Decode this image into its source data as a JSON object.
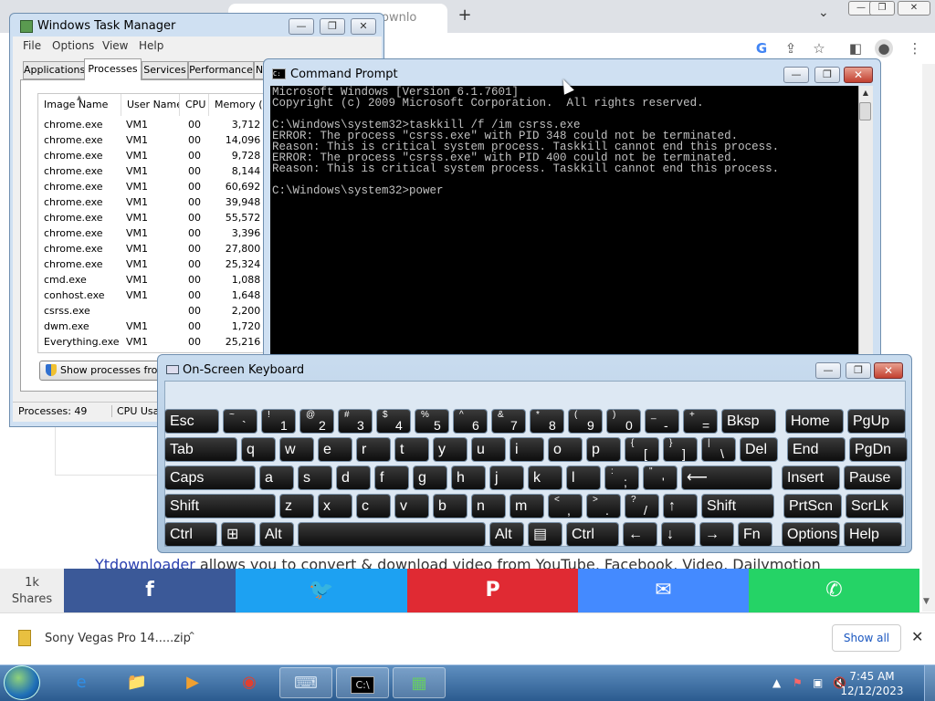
{
  "chrome": {
    "tab_fragment": "ownlo",
    "new_tab_glyph": "+",
    "tabs_dropdown_glyph": "⌄",
    "window_buttons": [
      "—",
      "❐",
      "✕"
    ],
    "omnibox_icons": [
      "google-icon",
      "share-icon",
      "star-icon",
      "sidebar-icon",
      "profile-icon",
      "menu-icon"
    ]
  },
  "page": {
    "ytd_link": "Ytdownloader",
    "ytd_text": " allows you to convert & download video from YouTube, Facebook, Video, Dailymotion",
    "shares_count": "1k",
    "shares_label": "Shares",
    "share_buttons": [
      {
        "name": "facebook",
        "glyph": "f",
        "color": "#3b5998"
      },
      {
        "name": "twitter",
        "glyph": "🐦",
        "color": "#1da1f2"
      },
      {
        "name": "pinterest",
        "glyph": "P",
        "color": "#e02a33"
      },
      {
        "name": "messenger",
        "glyph": "✉",
        "color": "#448aff"
      },
      {
        "name": "whatsapp",
        "glyph": "✆",
        "color": "#25d366"
      }
    ]
  },
  "download_bar": {
    "file_name": "Sony Vegas Pro 14.....zip",
    "chevron": "⌃",
    "show_all": "Show all",
    "close": "✕"
  },
  "task_manager": {
    "title": "Windows Task Manager",
    "menu": [
      "File",
      "Options",
      "View",
      "Help"
    ],
    "tabs": [
      "Applications",
      "Processes",
      "Services",
      "Performance",
      "N"
    ],
    "selected_tab": "Processes",
    "columns": [
      "Image Name",
      "User Name",
      "CPU",
      "Memory (..."
    ],
    "rows": [
      {
        "image": "chrome.exe",
        "user": "VM1",
        "cpu": "00",
        "mem": "3,712 K"
      },
      {
        "image": "chrome.exe",
        "user": "VM1",
        "cpu": "00",
        "mem": "14,096 K"
      },
      {
        "image": "chrome.exe",
        "user": "VM1",
        "cpu": "00",
        "mem": "9,728 K"
      },
      {
        "image": "chrome.exe",
        "user": "VM1",
        "cpu": "00",
        "mem": "8,144 K"
      },
      {
        "image": "chrome.exe",
        "user": "VM1",
        "cpu": "00",
        "mem": "60,692 K"
      },
      {
        "image": "chrome.exe",
        "user": "VM1",
        "cpu": "00",
        "mem": "39,948 K"
      },
      {
        "image": "chrome.exe",
        "user": "VM1",
        "cpu": "00",
        "mem": "55,572 K"
      },
      {
        "image": "chrome.exe",
        "user": "VM1",
        "cpu": "00",
        "mem": "3,396 K"
      },
      {
        "image": "chrome.exe",
        "user": "VM1",
        "cpu": "00",
        "mem": "27,800 K"
      },
      {
        "image": "chrome.exe",
        "user": "VM1",
        "cpu": "00",
        "mem": "25,324 K"
      },
      {
        "image": "cmd.exe",
        "user": "VM1",
        "cpu": "00",
        "mem": "1,088 K"
      },
      {
        "image": "conhost.exe",
        "user": "VM1",
        "cpu": "00",
        "mem": "1,648 K"
      },
      {
        "image": "csrss.exe",
        "user": "",
        "cpu": "00",
        "mem": "2,200 K"
      },
      {
        "image": "dwm.exe",
        "user": "VM1",
        "cpu": "00",
        "mem": "1,720 K"
      },
      {
        "image": "Everything.exe",
        "user": "VM1",
        "cpu": "00",
        "mem": "25,216 K"
      }
    ],
    "show_processes_btn": "Show processes from",
    "status_processes": "Processes: 49",
    "status_cpu": "CPU Usa"
  },
  "cmd": {
    "title": "Command Prompt",
    "lines": [
      "Microsoft Windows [Version 6.1.7601]",
      "Copyright (c) 2009 Microsoft Corporation.  All rights reserved.",
      "",
      "C:\\Windows\\system32>taskkill /f /im csrss.exe",
      "ERROR: The process \"csrss.exe\" with PID 348 could not be terminated.",
      "Reason: This is critical system process. Taskkill cannot end this process.",
      "ERROR: The process \"csrss.exe\" with PID 400 could not be terminated.",
      "Reason: This is critical system process. Taskkill cannot end this process.",
      "",
      "C:\\Windows\\system32>power"
    ]
  },
  "osk": {
    "title": "On-Screen Keyboard",
    "rows": [
      [
        {
          "id": "esc",
          "label": "Esc",
          "w": 60
        },
        {
          "id": "tilde",
          "sup": "~",
          "main": "`",
          "w": 38
        },
        {
          "id": "k1",
          "sup": "!",
          "main": "1",
          "w": 38
        },
        {
          "id": "k2",
          "sup": "@",
          "main": "2",
          "w": 38
        },
        {
          "id": "k3",
          "sup": "#",
          "main": "3",
          "w": 38
        },
        {
          "id": "k4",
          "sup": "$",
          "main": "4",
          "w": 38
        },
        {
          "id": "k5",
          "sup": "%",
          "main": "5",
          "w": 38
        },
        {
          "id": "k6",
          "sup": "^",
          "main": "6",
          "w": 38
        },
        {
          "id": "k7",
          "sup": "&",
          "main": "7",
          "w": 38
        },
        {
          "id": "k8",
          "sup": "*",
          "main": "8",
          "w": 38
        },
        {
          "id": "k9",
          "sup": "(",
          "main": "9",
          "w": 38
        },
        {
          "id": "k0",
          "sup": ")",
          "main": "0",
          "w": 38
        },
        {
          "id": "minus",
          "sup": "_",
          "main": "-",
          "w": 38
        },
        {
          "id": "equals",
          "sup": "+",
          "main": "=",
          "w": 38
        },
        {
          "id": "bksp",
          "label": "Bksp",
          "w": 60
        },
        {
          "id": "home",
          "label": "Home",
          "w": 64,
          "gap": 6
        },
        {
          "id": "pgup",
          "label": "PgUp",
          "w": 64
        }
      ],
      [
        {
          "id": "tab",
          "label": "Tab",
          "w": 80
        },
        {
          "id": "q",
          "label": "q",
          "w": 38
        },
        {
          "id": "w",
          "label": "w",
          "w": 38
        },
        {
          "id": "e",
          "label": "e",
          "w": 38
        },
        {
          "id": "r",
          "label": "r",
          "w": 38
        },
        {
          "id": "t",
          "label": "t",
          "w": 38
        },
        {
          "id": "y",
          "label": "y",
          "w": 38
        },
        {
          "id": "u",
          "label": "u",
          "w": 38
        },
        {
          "id": "i",
          "label": "i",
          "w": 38
        },
        {
          "id": "o",
          "label": "o",
          "w": 38
        },
        {
          "id": "p",
          "label": "p",
          "w": 38
        },
        {
          "id": "lbracket",
          "sup": "{",
          "main": "[",
          "w": 38
        },
        {
          "id": "rbracket",
          "sup": "}",
          "main": "]",
          "w": 38
        },
        {
          "id": "backslash",
          "sup": "|",
          "main": "\\",
          "w": 38
        },
        {
          "id": "del",
          "label": "Del",
          "w": 42
        },
        {
          "id": "end",
          "label": "End",
          "w": 64,
          "gap": 6
        },
        {
          "id": "pgdn",
          "label": "PgDn",
          "w": 64
        }
      ],
      [
        {
          "id": "caps",
          "label": "Caps",
          "w": 100
        },
        {
          "id": "a",
          "label": "a",
          "w": 38
        },
        {
          "id": "s",
          "label": "s",
          "w": 38
        },
        {
          "id": "d",
          "label": "d",
          "w": 38
        },
        {
          "id": "f",
          "label": "f",
          "w": 38
        },
        {
          "id": "g",
          "label": "g",
          "w": 38
        },
        {
          "id": "h",
          "label": "h",
          "w": 38
        },
        {
          "id": "j",
          "label": "j",
          "w": 38
        },
        {
          "id": "k",
          "label": "k",
          "w": 38
        },
        {
          "id": "l",
          "label": "l",
          "w": 38
        },
        {
          "id": "semicolon",
          "sup": ":",
          "main": ";",
          "w": 38
        },
        {
          "id": "quote",
          "sup": "\"",
          "main": "'",
          "w": 38
        },
        {
          "id": "enter",
          "label": "⟵",
          "w": 100
        },
        {
          "id": "insert",
          "label": "Insert",
          "w": 64,
          "gap": 6
        },
        {
          "id": "pause",
          "label": "Pause",
          "w": 64
        }
      ],
      [
        {
          "id": "lshift",
          "label": "Shift",
          "w": 122
        },
        {
          "id": "z",
          "label": "z",
          "w": 38
        },
        {
          "id": "x",
          "label": "x",
          "w": 38
        },
        {
          "id": "c",
          "label": "c",
          "w": 38
        },
        {
          "id": "v",
          "label": "v",
          "w": 38
        },
        {
          "id": "b",
          "label": "b",
          "w": 38
        },
        {
          "id": "n",
          "label": "n",
          "w": 38
        },
        {
          "id": "m",
          "label": "m",
          "w": 38
        },
        {
          "id": "comma",
          "sup": "<",
          "main": ",",
          "w": 38
        },
        {
          "id": "period",
          "sup": ">",
          "main": ".",
          "w": 38
        },
        {
          "id": "slash",
          "sup": "?",
          "main": "/",
          "w": 38
        },
        {
          "id": "up",
          "label": "↑",
          "w": 38
        },
        {
          "id": "rshift",
          "label": "Shift",
          "w": 80
        },
        {
          "id": "prtscn",
          "label": "PrtScn",
          "w": 64,
          "gap": 6
        },
        {
          "id": "scrlk",
          "label": "ScrLk",
          "w": 64
        }
      ],
      [
        {
          "id": "lctrl",
          "label": "Ctrl",
          "w": 58
        },
        {
          "id": "win",
          "label": "⊞",
          "w": 38
        },
        {
          "id": "alt",
          "label": "Alt",
          "w": 38
        },
        {
          "id": "space",
          "label": "",
          "w": 206
        },
        {
          "id": "altgr",
          "label": "Alt",
          "w": 38
        },
        {
          "id": "menu",
          "label": "▤",
          "w": 38
        },
        {
          "id": "rctrl",
          "label": "Ctrl",
          "w": 58
        },
        {
          "id": "left",
          "label": "←",
          "w": 38
        },
        {
          "id": "down",
          "label": "↓",
          "w": 38
        },
        {
          "id": "right",
          "label": "→",
          "w": 38
        },
        {
          "id": "fn",
          "label": "Fn",
          "w": 38
        },
        {
          "id": "options",
          "label": "Options",
          "w": 64,
          "gap": 6
        },
        {
          "id": "help",
          "label": "Help",
          "w": 64
        }
      ]
    ]
  },
  "taskbar": {
    "clock_time": "7:45 AM",
    "clock_date": "12/12/2023",
    "tray": [
      "▲",
      "⚑",
      "▣",
      "🔇"
    ],
    "apps": [
      {
        "name": "internet-explorer",
        "glyph": "e",
        "color": "#2e8fe8"
      },
      {
        "name": "file-explorer",
        "glyph": "📁",
        "color": "#e8c060"
      },
      {
        "name": "media-player",
        "glyph": "▶",
        "color": "#f0a030"
      },
      {
        "name": "chrome",
        "glyph": "◉",
        "color": "#e04030"
      },
      {
        "name": "on-screen-keyboard",
        "glyph": "⌨",
        "color": "#d0e0f0"
      },
      {
        "name": "command-prompt",
        "glyph": "C:\\",
        "color": "#ddd"
      },
      {
        "name": "task-manager",
        "glyph": "▦",
        "color": "#6c6"
      }
    ]
  }
}
